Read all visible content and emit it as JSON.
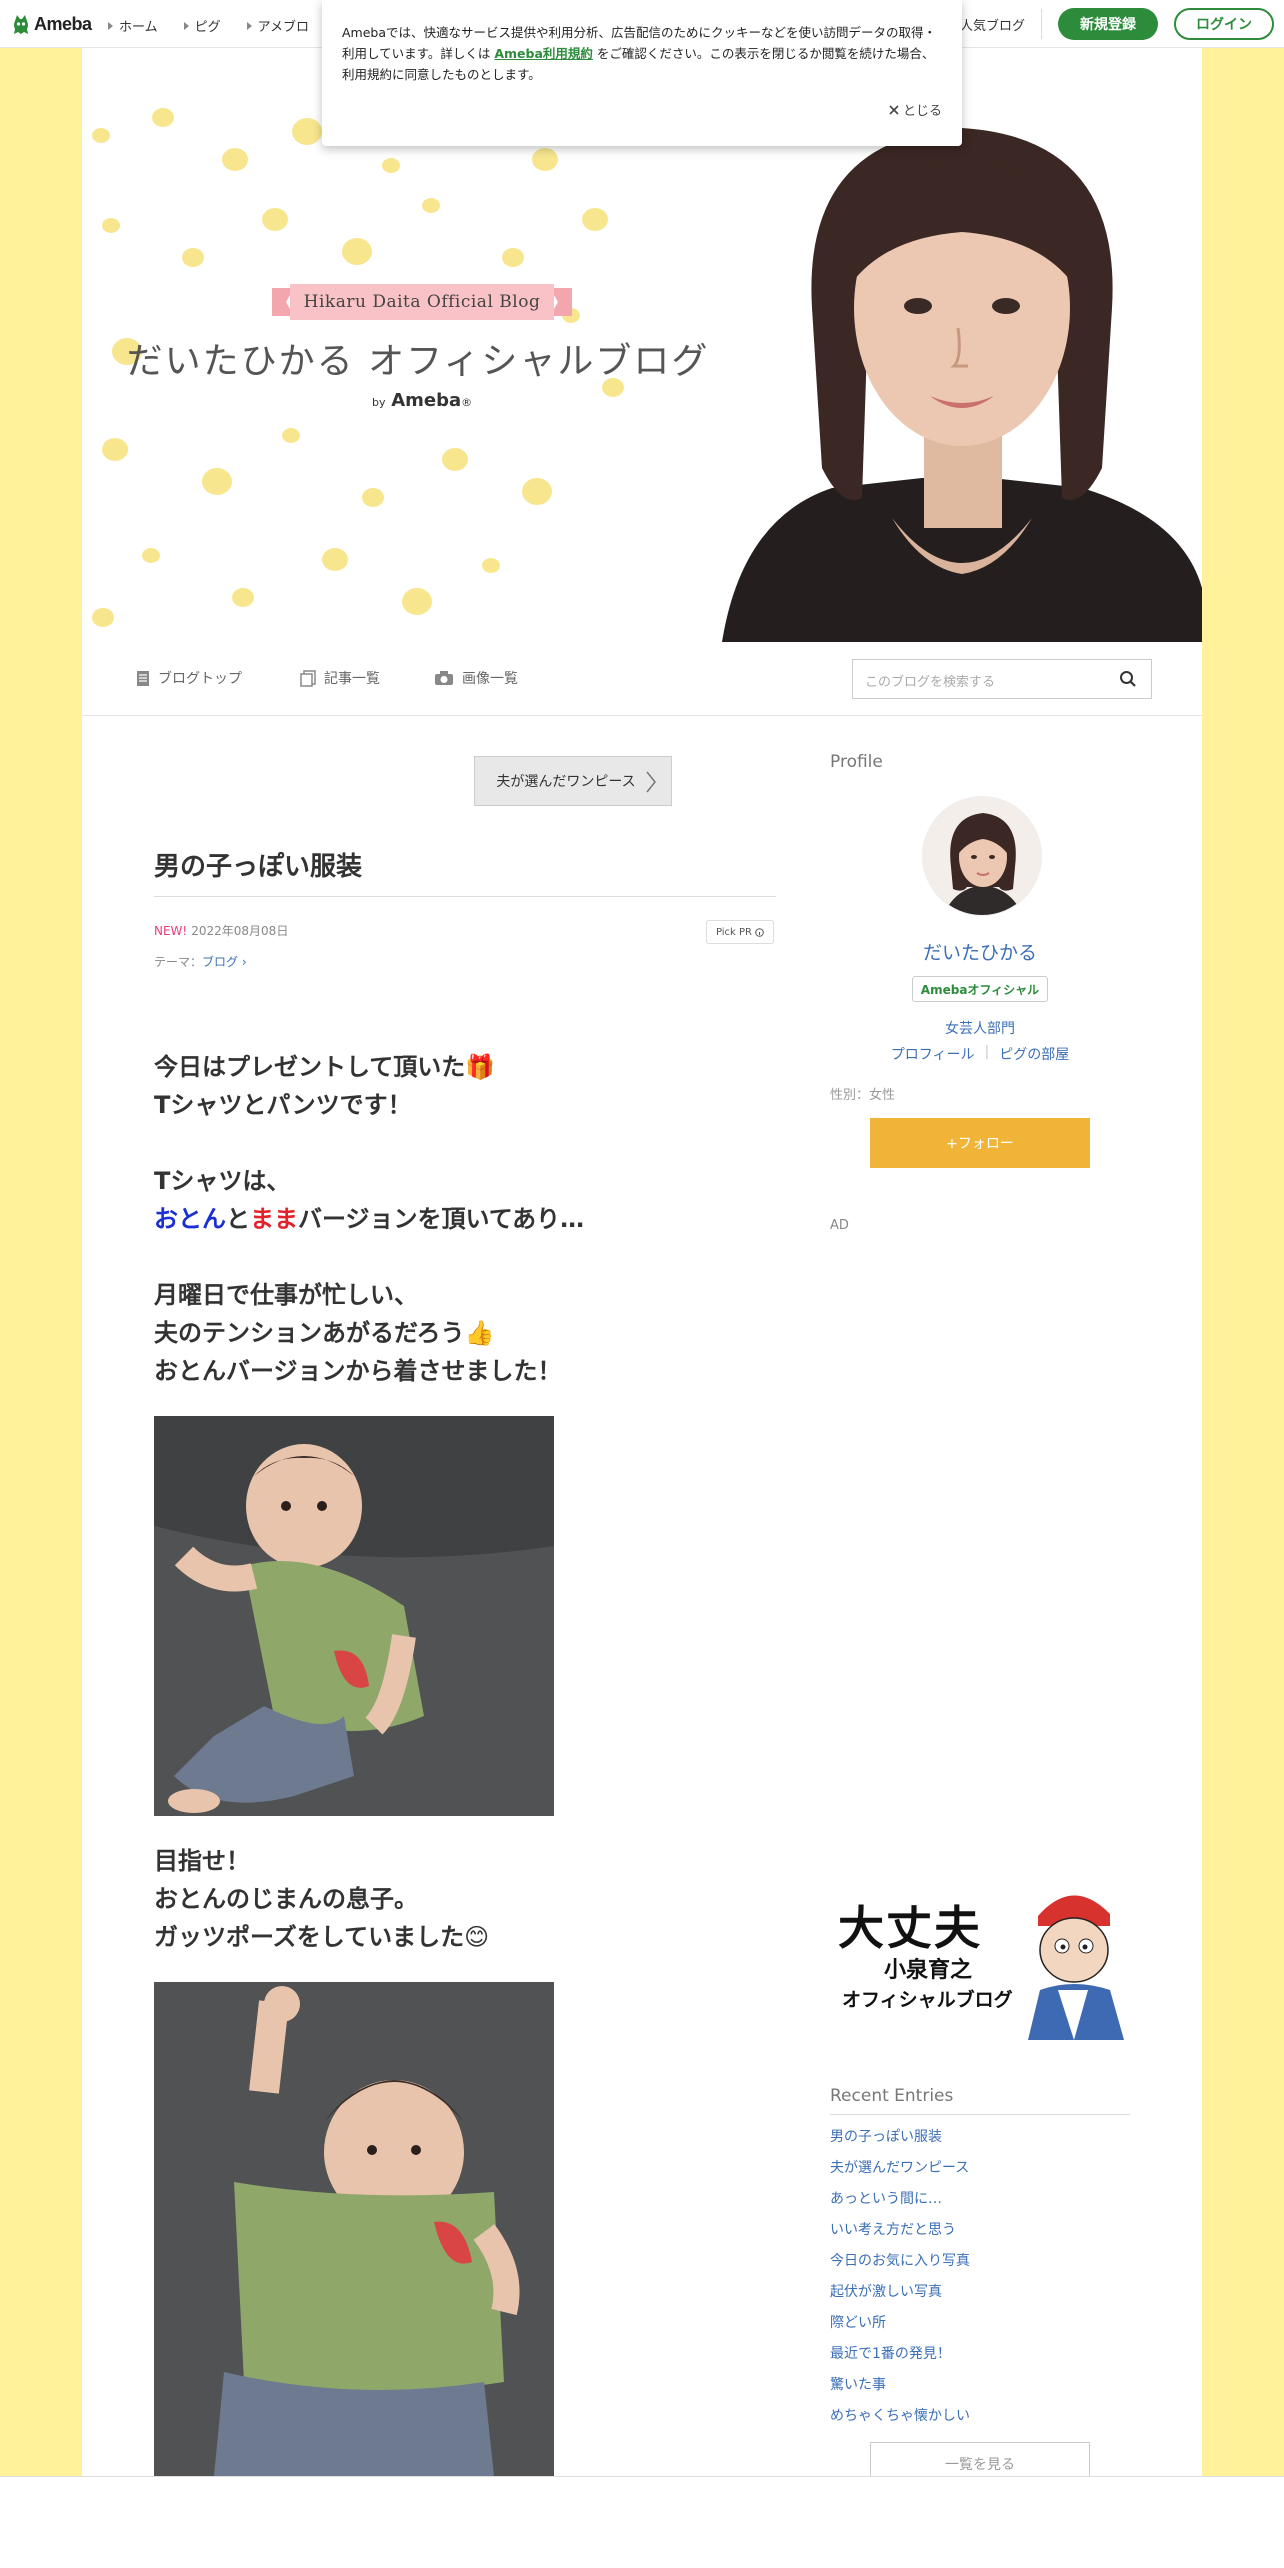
{
  "topbar": {
    "logo": "Ameba",
    "nav": [
      "ホーム",
      "ピグ",
      "アメブロ"
    ],
    "popular": "人気ブログ",
    "register": "新規登録",
    "login": "ログイン"
  },
  "cookie": {
    "text_before": "Amebaでは、快適なサービス提供や利用分析、広告配信のためにクッキーなどを使い訪問データの取得・利用しています。詳しくは ",
    "link": "Ameba利用規約",
    "text_after": " をご確認ください。この表示を閉じるか閲覧を続けた場合、利用規約に同意したものとします。",
    "close": "とじる"
  },
  "banner": {
    "ribbon": "Hikaru Daita Official Blog",
    "title": "だいたひかる オフィシャルブログ",
    "by": "by",
    "brand": "Ameba",
    "brand_mark": "®"
  },
  "blognav": {
    "top": "ブログトップ",
    "list": "記事一覧",
    "images": "画像一覧",
    "search_placeholder": "このブログを検索する"
  },
  "post": {
    "prev_entry": "夫が選んだワンピース",
    "title": "男の子っぽい服装",
    "new_label": "NEW!",
    "date": "2022年08月08日",
    "pickpr": "Pick PR",
    "theme_label": "テーマ：",
    "theme": "ブログ",
    "p1_l1": "今日はプレゼントして頂いた🎁",
    "p1_l2": "Tシャツとパンツです！",
    "p2_l1": "Tシャツは、",
    "p2_blue": "おとん",
    "p2_to": "と",
    "p2_red": "まま",
    "p2_rest": "バージョンを頂いてあり…",
    "p3_l1": "月曜日で仕事が忙しい、",
    "p3_l2": "夫のテンションあがるだろう👍",
    "p3_l3": "おとんバージョンから着させました！",
    "p4_l1": "目指せ！",
    "p4_l2": "おとんのじまんの息子。",
    "p4_l3": "ガッツポーズをしていました😊"
  },
  "sidebar": {
    "profile_heading": "Profile",
    "name": "だいたひかる",
    "official": "Amebaオフィシャル",
    "category": "女芸人部門",
    "profile_link": "プロフィール",
    "pig_link": "ピグの部屋",
    "gender": "性別：女性",
    "follow": "+フォロー",
    "ad": "AD",
    "ad_line1": "大丈夫",
    "ad_line2": "小泉育之",
    "ad_line3": "オフィシャルブログ",
    "recent_heading": "Recent Entries",
    "entries": [
      "男の子っぽい服装",
      "夫が選んだワンピース",
      "あっという間に…",
      "いい考え方だと思う",
      "今日のお気に入り写真",
      "起伏が激しい写真",
      "際どい所",
      "最近で1番の発見！",
      "驚いた事",
      "めちゃくちゃ懐かしい"
    ],
    "more": "一覧を見る"
  }
}
